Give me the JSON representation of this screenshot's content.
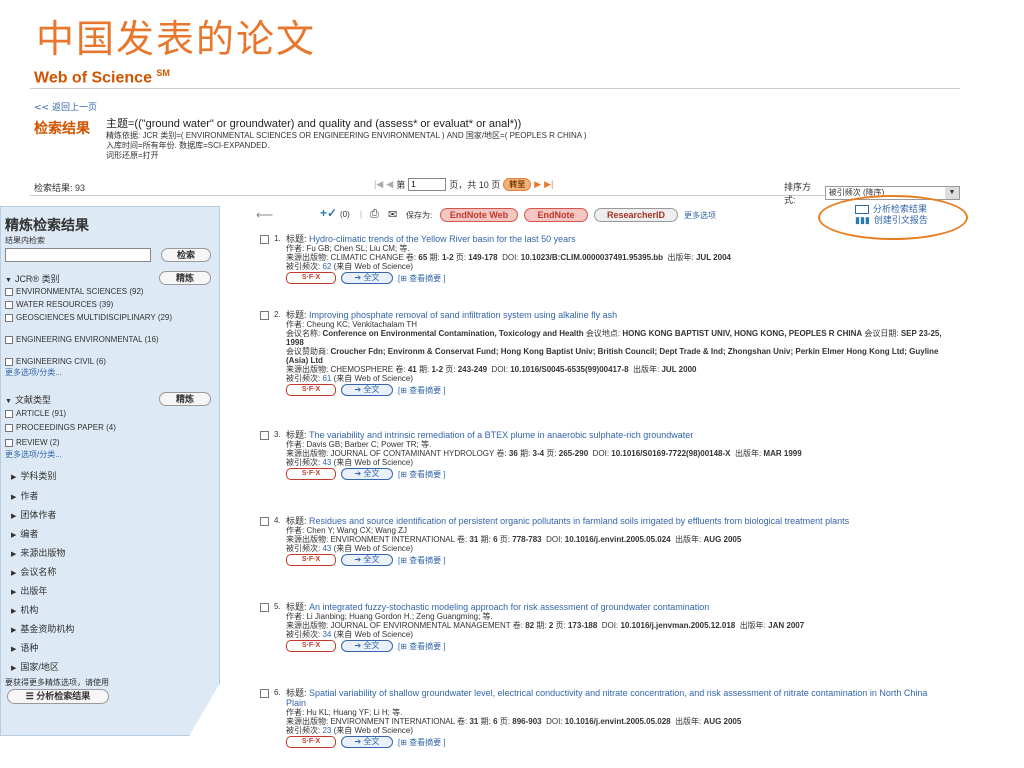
{
  "slide_title": "中国发表的论文",
  "header": {
    "logo": "Web of Science",
    "logo_sup": "SM",
    "back_link": "<< 返回上一页"
  },
  "query": {
    "label": "检索结果",
    "main": "主题=((\"ground water\" or groundwater) and quality and (assess* or evaluat* or anal*))",
    "refine_line": "精炼依据: JCR 类别=( ENVIRONMENTAL SCIENCES OR ENGINEERING ENVIRONMENTAL ) AND 国家/地区=( PEOPLES R CHINA )",
    "time_line": "入库时间=所有年份. 数据库=SCI-EXPANDED.",
    "lemma_line": "词形还原=打开"
  },
  "count_bar": {
    "count_text": "检索结果:  93",
    "page_prefix": "第",
    "page_value": "1",
    "page_suffix": "页，共 10 页",
    "go_label": "转至",
    "sort_label": "排序方式:",
    "sort_value": "被引频次 (降序)"
  },
  "sidebar": {
    "title": "精炼检索结果",
    "within_label": "结果内检索",
    "search_btn": "检索",
    "jcr_label": "JCR® 类别",
    "refine_btn": "精炼",
    "jcr_items": [
      "ENVIRONMENTAL SCIENCES (92)",
      "WATER RESOURCES (39)",
      "GEOSCIENCES MULTIDISCIPLINARY (29)",
      "ENGINEERING ENVIRONMENTAL (16)",
      "ENGINEERING CIVIL (6)"
    ],
    "more1": "更多选项/分类...",
    "doc_label": "文献类型",
    "doc_items": [
      "ARTICLE (91)",
      "PROCEEDINGS PAPER (4)",
      "REVIEW (2)"
    ],
    "more2": "更多选项/分类...",
    "collapsed": [
      "学科类别",
      "作者",
      "团体作者",
      "编者",
      "来源出版物",
      "会议名称",
      "出版年",
      "机构",
      "基金资助机构",
      "语种",
      "国家/地区"
    ],
    "note": "要获得更多精炼选项，请使用",
    "analyze_btn": "☰ 分析检索结果"
  },
  "toolbar": {
    "marked": "(0)",
    "save_as": "保存为:",
    "endnote_web": "EndNote Web",
    "endnote": "EndNote",
    "researcherid": "ResearcherID",
    "more": "更多选项"
  },
  "analyze_panel": {
    "analyze": "分析检索结果",
    "citation": "创建引文报告"
  },
  "records": [
    {
      "num": "1.",
      "title": "Hydro-climatic trends of the Yellow River basin for the last 50 years",
      "authors": "作者: Fu GB; Chen SL; Liu CM; 等.",
      "source": "CLIMATIC CHANGE",
      "vol": "65",
      "issue": "1-2",
      "pages": "149-178",
      "doi": "10.1023/B:CLIM.0000037491.95395.bb",
      "year": "JUL 2004",
      "cited": "62"
    },
    {
      "num": "2.",
      "title": "Improving phosphate removal of sand infiltration system using alkaline fly ash",
      "authors": "作者: Cheung KC; Venkitachalam TH",
      "conf_name": "Conference on Environmental Contamination, Toxicology and Health",
      "conf_loc": "HONG KONG BAPTIST UNIV, HONG KONG, PEOPLES R CHINA",
      "conf_date": "SEP 23-25, 1998",
      "sponsors": "Croucher Fdn; Environm & Conservat Fund; Hong Kong Baptist Univ; British Council; Dept Trade & Ind; Zhongshan Univ; Perkin Elmer Hong Kong Ltd; Guyline (Asia) Ltd",
      "source": "CHEMOSPHERE",
      "vol": "41",
      "issue": "1-2",
      "pages": "243-249",
      "doi": "10.1016/S0045-6535(99)00417-8",
      "year": "JUL 2000",
      "cited": "61"
    },
    {
      "num": "3.",
      "title": "The variability and intrinsic remediation of a BTEX plume in anaerobic sulphate-rich groundwater",
      "authors": "作者: Davis GB; Barber C; Power TR; 等.",
      "source": "JOURNAL OF CONTAMINANT HYDROLOGY",
      "vol": "36",
      "issue": "3-4",
      "pages": "265-290",
      "doi": "10.1016/S0169-7722(98)00148-X",
      "year": "MAR 1999",
      "cited": "43"
    },
    {
      "num": "4.",
      "title": "Residues and source identification of persistent organic pollutants in farmland soils irrigated by effluents from biological treatment plants",
      "authors": "作者: Chen Y; Wang CX; Wang ZJ",
      "source": "ENVIRONMENT INTERNATIONAL",
      "vol": "31",
      "issue": "6",
      "pages": "778-783",
      "doi": "10.1016/j.envint.2005.05.024",
      "year": "AUG 2005",
      "cited": "43"
    },
    {
      "num": "5.",
      "title": "An integrated fuzzy-stochastic modeling approach for risk assessment of groundwater contamination",
      "authors": "作者: Li Jianbing; Huang Gordon H.; Zeng Guangming; 等.",
      "source": "JOURNAL OF ENVIRONMENTAL MANAGEMENT",
      "vol": "82",
      "issue": "2",
      "pages": "173-188",
      "doi": "10.1016/j.jenvman.2005.12.018",
      "year": "JAN 2007",
      "cited": "34"
    },
    {
      "num": "6.",
      "title": "Spatial variability of shallow groundwater level, electrical conductivity and nitrate concentration, and risk assessment of nitrate contamination in North China Plain",
      "authors": "作者: Hu KL; Huang YF; Li H; 等.",
      "source": "ENVIRONMENT INTERNATIONAL",
      "vol": "31",
      "issue": "6",
      "pages": "896-903",
      "doi": "10.1016/j.envint.2005.05.028",
      "year": "AUG 2005",
      "cited": "23"
    }
  ],
  "labels": {
    "title": "标题:",
    "source": "来源出版物:",
    "vol": "卷:",
    "issue": "期:",
    "pages": "页:",
    "doi": "DOI:",
    "year": "出版年:",
    "cited_prefix": "被引频次:",
    "cited_suffix": "(来自 Web of Science)",
    "conf_name": "会议名称:",
    "conf_loc": "会议地点:",
    "conf_date": "会议日期:",
    "sponsor": "会议赞助商:",
    "sfx": "S·F·X",
    "fulltext": "➔ 全文",
    "abstract": "[⊞ 查看摘要 ]"
  }
}
